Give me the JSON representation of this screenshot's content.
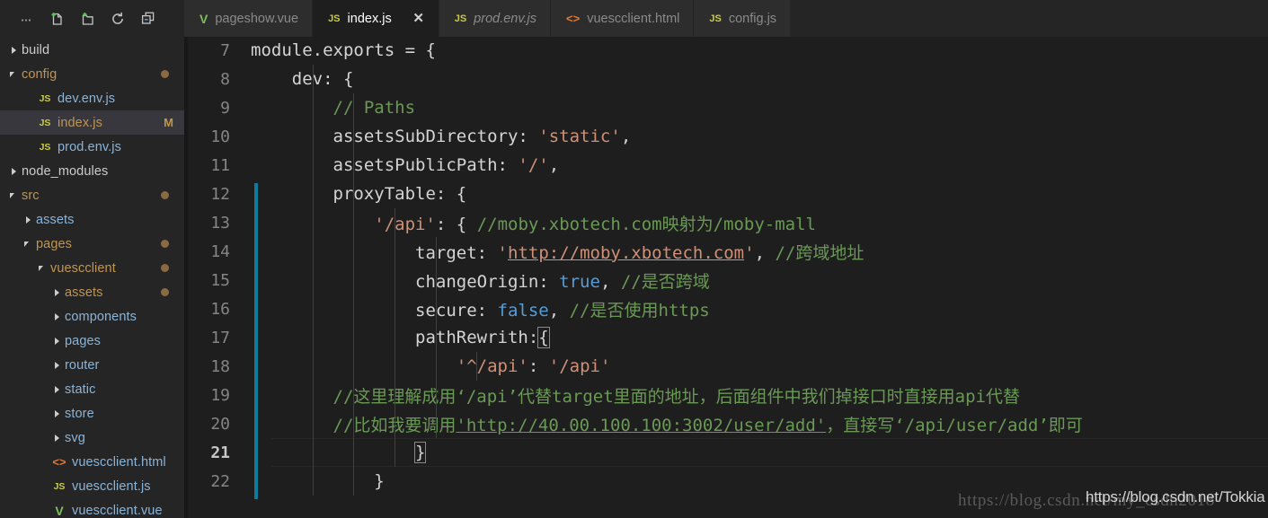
{
  "sidebar": {
    "toolbar": [
      {
        "name": "more-actions-icon",
        "label": "..."
      },
      {
        "name": "new-file-icon",
        "label": "New File"
      },
      {
        "name": "new-folder-icon",
        "label": "New Folder"
      },
      {
        "name": "refresh-icon",
        "label": "Refresh Explorer"
      },
      {
        "name": "collapse-all-icon",
        "label": "Collapse Folders in Explorer"
      }
    ],
    "tree": [
      {
        "label": "build",
        "indent": 0,
        "twist": "closed",
        "icon": "none",
        "color": "plain",
        "dot": false,
        "badge": "",
        "selected": false
      },
      {
        "label": "config",
        "indent": 0,
        "twist": "open",
        "icon": "none",
        "color": "mod",
        "dot": true,
        "badge": "",
        "selected": false
      },
      {
        "label": "dev.env.js",
        "indent": 1,
        "twist": "none",
        "icon": "js",
        "color": "blue",
        "dot": false,
        "badge": "",
        "selected": false
      },
      {
        "label": "index.js",
        "indent": 1,
        "twist": "none",
        "icon": "js",
        "color": "mod",
        "dot": false,
        "badge": "M",
        "selected": true
      },
      {
        "label": "prod.env.js",
        "indent": 1,
        "twist": "none",
        "icon": "js",
        "color": "blue",
        "dot": false,
        "badge": "",
        "selected": false
      },
      {
        "label": "node_modules",
        "indent": 0,
        "twist": "closed",
        "icon": "none",
        "color": "plain",
        "dot": false,
        "badge": "",
        "selected": false
      },
      {
        "label": "src",
        "indent": 0,
        "twist": "open",
        "icon": "none",
        "color": "mod",
        "dot": true,
        "badge": "",
        "selected": false
      },
      {
        "label": "assets",
        "indent": 1,
        "twist": "closed",
        "icon": "none",
        "color": "blue",
        "dot": false,
        "badge": "",
        "selected": false
      },
      {
        "label": "pages",
        "indent": 1,
        "twist": "open",
        "icon": "none",
        "color": "mod",
        "dot": true,
        "badge": "",
        "selected": false
      },
      {
        "label": "vuescclient",
        "indent": 2,
        "twist": "open",
        "icon": "none",
        "color": "mod",
        "dot": true,
        "badge": "",
        "selected": false
      },
      {
        "label": "assets",
        "indent": 3,
        "twist": "closed",
        "icon": "none",
        "color": "mod",
        "dot": true,
        "badge": "",
        "selected": false
      },
      {
        "label": "components",
        "indent": 3,
        "twist": "closed",
        "icon": "none",
        "color": "blue",
        "dot": false,
        "badge": "",
        "selected": false
      },
      {
        "label": "pages",
        "indent": 3,
        "twist": "closed",
        "icon": "none",
        "color": "blue",
        "dot": false,
        "badge": "",
        "selected": false
      },
      {
        "label": "router",
        "indent": 3,
        "twist": "closed",
        "icon": "none",
        "color": "blue",
        "dot": false,
        "badge": "",
        "selected": false
      },
      {
        "label": "static",
        "indent": 3,
        "twist": "closed",
        "icon": "none",
        "color": "blue",
        "dot": false,
        "badge": "",
        "selected": false
      },
      {
        "label": "store",
        "indent": 3,
        "twist": "closed",
        "icon": "none",
        "color": "blue",
        "dot": false,
        "badge": "",
        "selected": false
      },
      {
        "label": "svg",
        "indent": 3,
        "twist": "closed",
        "icon": "none",
        "color": "blue",
        "dot": false,
        "badge": "",
        "selected": false
      },
      {
        "label": "vuescclient.html",
        "indent": 2,
        "twist": "none",
        "icon": "html",
        "color": "blue",
        "dot": false,
        "badge": "",
        "selected": false
      },
      {
        "label": "vuescclient.js",
        "indent": 2,
        "twist": "none",
        "icon": "js",
        "color": "blue",
        "dot": false,
        "badge": "",
        "selected": false
      },
      {
        "label": "vuescclient.vue",
        "indent": 2,
        "twist": "none",
        "icon": "vue",
        "color": "blue",
        "dot": false,
        "badge": "",
        "selected": false
      }
    ]
  },
  "tabs": [
    {
      "label": "pageshow.vue",
      "icon": "vue",
      "active": false,
      "italic": false,
      "close": false
    },
    {
      "label": "index.js",
      "icon": "js",
      "active": true,
      "italic": false,
      "close": true,
      "close_glyph": "✕"
    },
    {
      "label": "prod.env.js",
      "icon": "js",
      "active": false,
      "italic": true,
      "close": false
    },
    {
      "label": "vuescclient.html",
      "icon": "html",
      "active": false,
      "italic": false,
      "close": false
    },
    {
      "label": "config.js",
      "icon": "js",
      "active": false,
      "italic": false,
      "close": false
    }
  ],
  "editor": {
    "first_visible_line": 7,
    "active_line": 21,
    "git_modified_from_line": 12,
    "git_modified_to_line": 22,
    "lines": [
      {
        "num": 7,
        "text": "module.exports = {"
      },
      {
        "num": 8,
        "text": "    dev: {"
      },
      {
        "num": 9,
        "text": "        // Paths"
      },
      {
        "num": 10,
        "text": "        assetsSubDirectory: 'static',"
      },
      {
        "num": 11,
        "text": "        assetsPublicPath: '/',"
      },
      {
        "num": 12,
        "text": "        proxyTable: {"
      },
      {
        "num": 13,
        "text": "            '/api': { //moby.xbotech.com映射为/moby-mall"
      },
      {
        "num": 14,
        "text": "                target: 'http://moby.xbotech.com', //跨域地址"
      },
      {
        "num": 15,
        "text": "                changeOrigin: true, //是否跨域"
      },
      {
        "num": 16,
        "text": "                secure: false, //是否使用https"
      },
      {
        "num": 17,
        "text": "                pathRewrith:{"
      },
      {
        "num": 18,
        "text": "                    '^/api': '/api'"
      },
      {
        "num": 19,
        "text": "        //这里理解成用‘/api’代替target里面的地址，后面组件中我们掉接口时直接用api代替"
      },
      {
        "num": 20,
        "text": "        //比如我要调用'http://40.00.100.100:3002/user/add'，直接写‘/api/user/add’即可"
      },
      {
        "num": 21,
        "text": "                }"
      },
      {
        "num": 22,
        "text": "            }"
      }
    ],
    "tokens": {
      "l7": [
        {
          "t": "module.exports = {",
          "c": "plain"
        }
      ],
      "l8": [
        {
          "t": "    dev: {",
          "c": "plain"
        }
      ],
      "l9": [
        {
          "t": "        ",
          "c": "plain"
        },
        {
          "t": "// Paths",
          "c": "cmt"
        }
      ],
      "l10": [
        {
          "t": "        assetsSubDirectory: ",
          "c": "plain"
        },
        {
          "t": "'static'",
          "c": "str"
        },
        {
          "t": ",",
          "c": "plain"
        }
      ],
      "l11": [
        {
          "t": "        assetsPublicPath: ",
          "c": "plain"
        },
        {
          "t": "'/'",
          "c": "str"
        },
        {
          "t": ",",
          "c": "plain"
        }
      ],
      "l12": [
        {
          "t": "        proxyTable: {",
          "c": "plain"
        }
      ],
      "l13": [
        {
          "t": "            ",
          "c": "plain"
        },
        {
          "t": "'/api'",
          "c": "str"
        },
        {
          "t": ": { ",
          "c": "plain"
        },
        {
          "t": "//moby.xbotech.com映射为/moby-mall",
          "c": "cmt"
        }
      ],
      "l14": [
        {
          "t": "                target: ",
          "c": "plain"
        },
        {
          "t": "'",
          "c": "str"
        },
        {
          "t": "http://moby.xbotech.com",
          "c": "str-link"
        },
        {
          "t": "'",
          "c": "str"
        },
        {
          "t": ", ",
          "c": "plain"
        },
        {
          "t": "//跨域地址",
          "c": "cmt"
        }
      ],
      "l15": [
        {
          "t": "                changeOrigin: ",
          "c": "plain"
        },
        {
          "t": "true",
          "c": "kw"
        },
        {
          "t": ", ",
          "c": "plain"
        },
        {
          "t": "//是否跨域",
          "c": "cmt"
        }
      ],
      "l16": [
        {
          "t": "                secure: ",
          "c": "plain"
        },
        {
          "t": "false",
          "c": "kw"
        },
        {
          "t": ", ",
          "c": "plain"
        },
        {
          "t": "//是否使用https",
          "c": "cmt"
        }
      ],
      "l17": [
        {
          "t": "                pathRewrith:",
          "c": "plain"
        },
        {
          "t": "{",
          "c": "brkt"
        }
      ],
      "l18": [
        {
          "t": "                    ",
          "c": "plain"
        },
        {
          "t": "'^/api'",
          "c": "str"
        },
        {
          "t": ": ",
          "c": "plain"
        },
        {
          "t": "'/api'",
          "c": "str"
        }
      ],
      "l19": [
        {
          "t": "        //这里理解成用‘/api’代替IGNORE",
          "c": "cmt"
        }
      ],
      "l20": [
        {
          "t": "        //比如我要调用",
          "c": "cmt"
        },
        {
          "t": "'http://40.00.100.100:3002/user/add'",
          "c": "cmt-link"
        },
        {
          "t": "，直接写‘/api/user/add’即可",
          "c": "cmt"
        }
      ],
      "l21": [
        {
          "t": "                ",
          "c": "plain"
        },
        {
          "t": "}",
          "c": "brkt"
        }
      ],
      "l22": [
        {
          "t": "            }",
          "c": "plain"
        }
      ]
    }
  },
  "watermarks": {
    "serif": "https://blog.csdn.net/my_csdn2018",
    "sans": "https://blog.csdn.net/Tokkia"
  },
  "colors": {
    "editor_bg": "#1e1e1e",
    "sidebar_bg": "#252526",
    "tab_inactive_bg": "#2d2d2d",
    "selection_bg": "#37373d",
    "git_modified": "#0c7d9d",
    "comment": "#6a9955",
    "string": "#ce9178",
    "keyword": "#569cd6",
    "modified_label": "#c09553",
    "badge_dot": "#8b6a43"
  }
}
